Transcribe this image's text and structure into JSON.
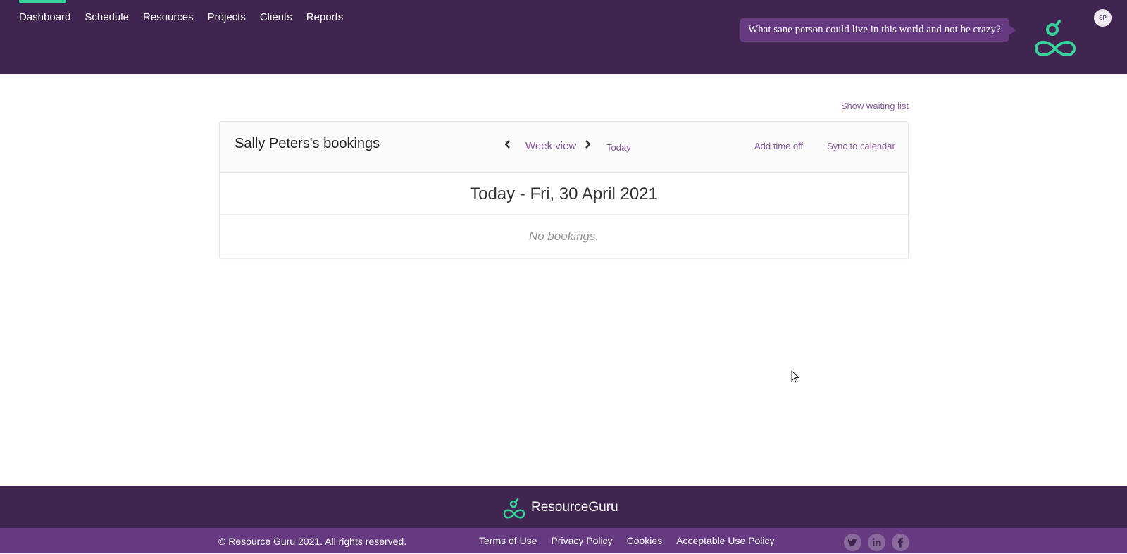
{
  "header": {
    "nav": [
      "Dashboard",
      "Schedule",
      "Resources",
      "Projects",
      "Clients",
      "Reports"
    ],
    "active_nav": "Dashboard",
    "quote": "What sane person could live in this world and not be crazy?",
    "avatar_initials": "SP"
  },
  "main": {
    "waiting_list_link": "Show waiting list",
    "title": "Sally Peters's bookings",
    "view_label": "Week view",
    "today_label": "Today",
    "add_time_off": "Add time off",
    "sync_calendar": "Sync to calendar",
    "date_heading": "Today - Fri, 30 April 2021",
    "empty_message": "No bookings."
  },
  "footer": {
    "brand": "ResourceGuru",
    "copyright": "© Resource Guru 2021. All rights reserved.",
    "links": [
      "Terms of Use",
      "Privacy Policy",
      "Cookies",
      "Acceptable Use Policy"
    ],
    "social": [
      "twitter-icon",
      "linkedin-icon",
      "facebook-icon"
    ]
  },
  "colors": {
    "header_bg": "#412551",
    "accent_green": "#36d39b",
    "link_purple": "#8a5aa1",
    "footer_bottom_bg": "#663a80"
  }
}
